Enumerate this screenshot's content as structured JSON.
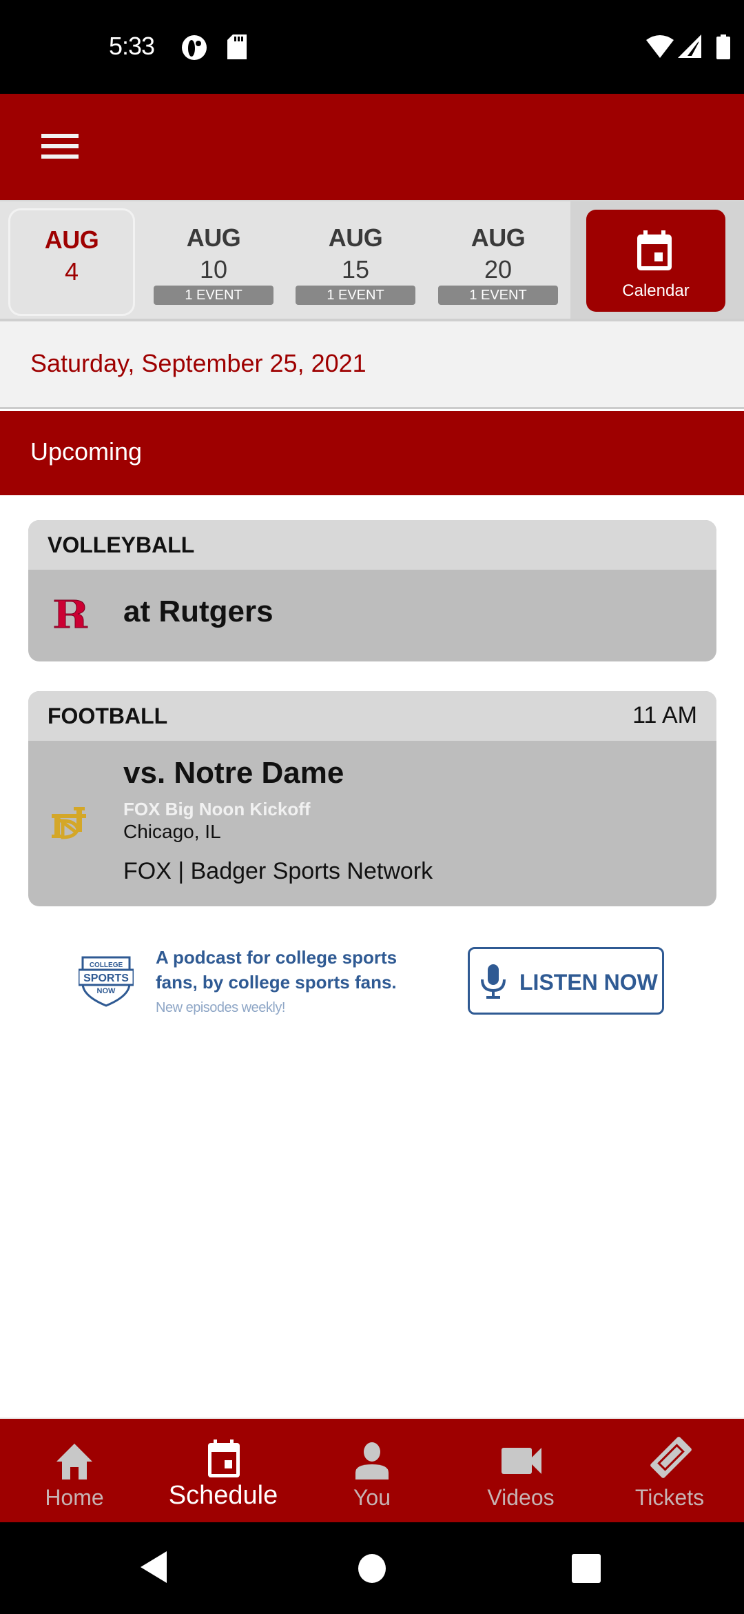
{
  "status_bar": {
    "time": "5:33",
    "left_icons": [
      "data-saver-icon",
      "sd-card-icon"
    ],
    "right_icons": [
      "wifi-icon",
      "signal-icon",
      "battery-icon"
    ]
  },
  "app_bar": {
    "menu_icon": "hamburger-menu-icon"
  },
  "date_strip": {
    "items": [
      {
        "month": "AUG",
        "day": "4",
        "badge": "",
        "selected": true
      },
      {
        "month": "AUG",
        "day": "10",
        "badge": "1 EVENT",
        "selected": false
      },
      {
        "month": "AUG",
        "day": "15",
        "badge": "1 EVENT",
        "selected": false
      },
      {
        "month": "AUG",
        "day": "20",
        "badge": "1 EVENT",
        "selected": false
      }
    ],
    "calendar_button": {
      "label": "Calendar",
      "icon": "calendar-icon"
    }
  },
  "selected_date": "Saturday, September 25, 2021",
  "section_header": "Upcoming",
  "events": [
    {
      "sport": "VOLLEYBALL",
      "time": "",
      "opponent": "at Rutgers",
      "logo": "rutgers-r-logo"
    },
    {
      "sport": "FOOTBALL",
      "time": "11 AM",
      "opponent": "vs. Notre Dame",
      "subtitle": "FOX Big Noon Kickoff",
      "location": "Chicago, IL",
      "tv": "FOX | Badger Sports Network",
      "logo": "notre-dame-nd-logo"
    }
  ],
  "promo": {
    "brand": "College Sports Now",
    "line1": "A podcast for college sports fans, by college sports fans.",
    "line2": "New episodes weekly!",
    "button_label": "LISTEN NOW"
  },
  "bottom_nav": {
    "items": [
      {
        "label": "Home",
        "icon": "home-icon",
        "active": false
      },
      {
        "label": "Schedule",
        "icon": "calendar-icon",
        "active": true
      },
      {
        "label": "You",
        "icon": "person-icon",
        "active": false
      },
      {
        "label": "Videos",
        "icon": "video-camera-icon",
        "active": false
      },
      {
        "label": "Tickets",
        "icon": "ticket-icon",
        "active": false
      }
    ]
  },
  "colors": {
    "primary": "#9e0000",
    "promo_blue": "#2f5a93",
    "nd_gold": "#d4a728",
    "rutgers_red": "#cc0033"
  }
}
